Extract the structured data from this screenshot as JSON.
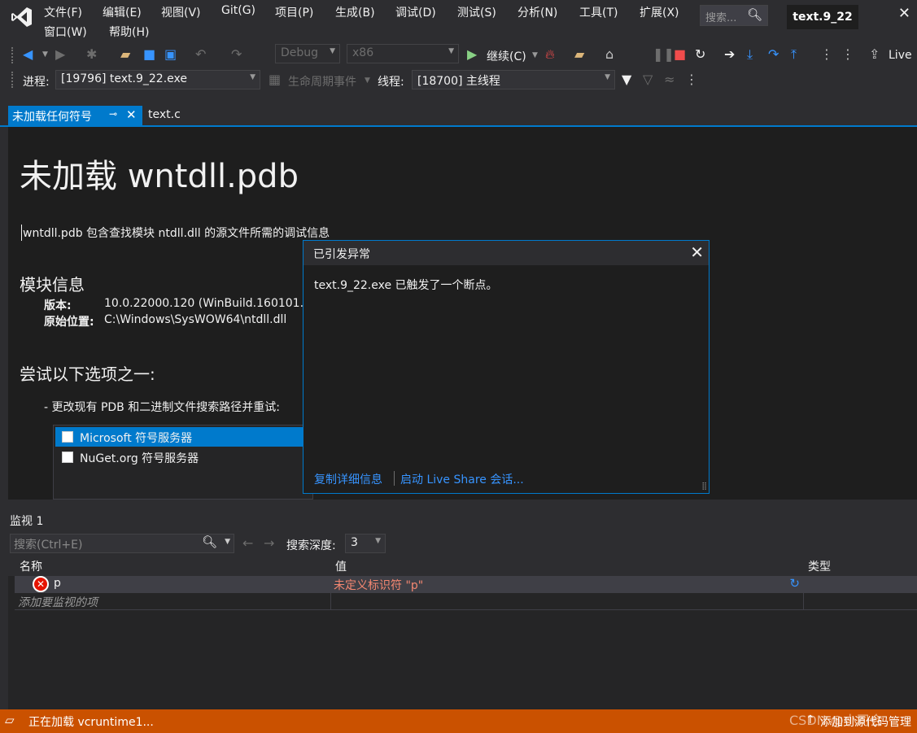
{
  "menu": {
    "items": [
      "文件(F)",
      "编辑(E)",
      "视图(V)",
      "Git(G)",
      "项目(P)",
      "生成(B)",
      "调试(D)",
      "测试(S)",
      "分析(N)",
      "工具(T)",
      "扩展(X)"
    ],
    "row2": [
      "窗口(W)",
      "帮助(H)"
    ],
    "search_placeholder": "搜索...",
    "solution_title": "text.9_22"
  },
  "toolbar": {
    "config": "Debug",
    "platform": "x86",
    "continue_label": "继续(C)",
    "live_label": "Live",
    "process_label": "进程:",
    "process_value": "[19796] text.9_22.exe",
    "lifecycle_label": "生命周期事件",
    "thread_label": "线程:",
    "thread_value": "[18700] 主线程"
  },
  "tabs": {
    "active": "未加载任何符号",
    "inactive": "text.c"
  },
  "doc": {
    "title": "未加载 wntdll.pdb",
    "description": "wntdll.pdb 包含查找模块 ntdll.dll 的源文件所需的调试信息",
    "module_heading": "模块信息",
    "version_key": "版本:",
    "version_value": "10.0.22000.120 (WinBuild.160101.",
    "location_key": "原始位置:",
    "location_value": "C:\\Windows\\SysWOW64\\ntdll.dll",
    "options_heading": "尝试以下选项之一:",
    "option1": "-  更改现有 PDB 和二进制文件搜索路径并重试:",
    "servers": [
      "Microsoft 符号服务器",
      "NuGet.org 符号服务器"
    ]
  },
  "exception": {
    "title": "已引发异常",
    "message": "text.9_22.exe 已触发了一个断点。",
    "link_copy": "复制详细信息",
    "link_share": "启动 Live Share 会话..."
  },
  "watch": {
    "title": "监视 1",
    "search_placeholder": "搜索(Ctrl+E)",
    "depth_label": "搜索深度:",
    "depth_value": "3",
    "columns": [
      "名称",
      "值",
      "类型"
    ],
    "rows": [
      {
        "name": "p",
        "value": "未定义标识符 \"p\"",
        "type": ""
      }
    ],
    "add_hint": "添加要监视的项"
  },
  "status": {
    "text": "正在加载 vcruntime1...",
    "right": "添加到源代码管理",
    "watermark": "CSDN @小司会"
  },
  "colors": {
    "accent": "#007acc",
    "status": "#ca5100",
    "error_text": "#f48771",
    "link": "#3794ff"
  }
}
